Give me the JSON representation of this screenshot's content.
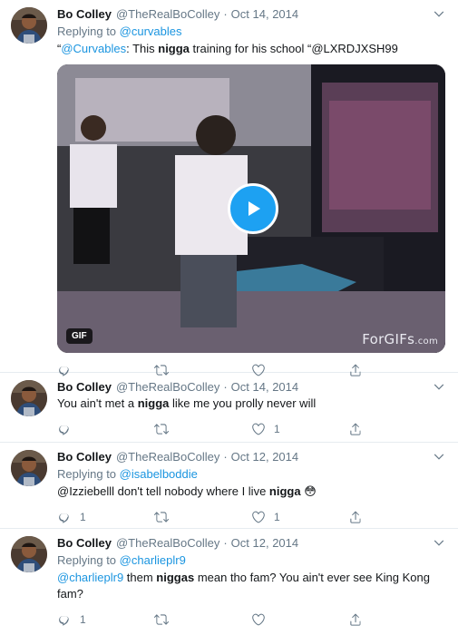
{
  "tweets": [
    {
      "name": "Bo Colley",
      "handle": "@TheRealBoColley",
      "date": "Oct 14, 2014",
      "replying_label": "Replying to ",
      "replying_to": "@curvables",
      "text": {
        "pre": "“",
        "mention": "@Curvables",
        "mid": ": This ",
        "bold": "nigga",
        "post": " training for his school  “@LXRDJXSH99"
      },
      "media": {
        "badge": "GIF",
        "watermark": "ForGIFs",
        "watermark_suffix": ".com"
      },
      "counts": {
        "reply": "",
        "retweet": "",
        "like": ""
      }
    },
    {
      "name": "Bo Colley",
      "handle": "@TheRealBoColley",
      "date": "Oct 14, 2014",
      "text": {
        "pre": "You ain't met a ",
        "bold": "nigga",
        "post": " like me you prolly never will"
      },
      "counts": {
        "reply": "",
        "retweet": "",
        "like": "1"
      }
    },
    {
      "name": "Bo Colley",
      "handle": "@TheRealBoColley",
      "date": "Oct 12, 2014",
      "replying_label": "Replying to ",
      "replying_to": "@isabelboddie",
      "text": {
        "pre": "@Izziebelll don't tell nobody where I live ",
        "bold": "nigga",
        "post": " 😳"
      },
      "counts": {
        "reply": "1",
        "retweet": "",
        "like": "1"
      }
    },
    {
      "name": "Bo Colley",
      "handle": "@TheRealBoColley",
      "date": "Oct 12, 2014",
      "replying_label": "Replying to ",
      "replying_to": "@charlieplr9",
      "text": {
        "mention": "@charlieplr9",
        "mid": " them ",
        "bold": "niggas",
        "post": " mean tho fam? You ain't ever see King Kong fam?"
      },
      "counts": {
        "reply": "1",
        "retweet": "",
        "like": ""
      }
    }
  ],
  "separator": "·",
  "colors": {
    "link": "#1b95e0",
    "meta": "#657786",
    "play": "#1da1f2",
    "border": "#e6ecf0"
  },
  "icons": [
    "reply-icon",
    "retweet-icon",
    "like-icon",
    "share-icon",
    "chevron-down-icon",
    "play-icon"
  ]
}
